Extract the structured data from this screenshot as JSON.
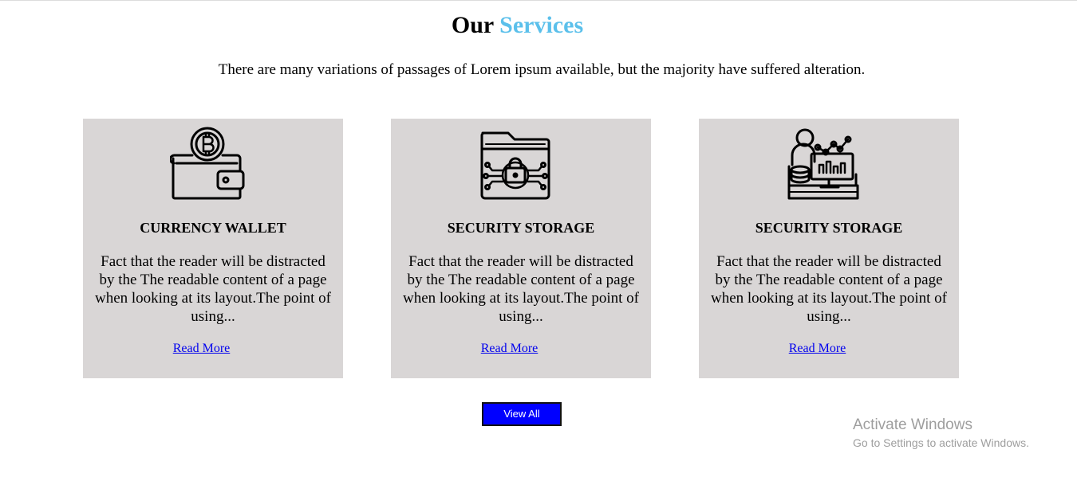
{
  "header": {
    "title_main": "Our",
    "title_accent": "Services",
    "subtitle": "There are many variations of passages of Lorem ipsum available, but the majority have suffered alteration."
  },
  "colors": {
    "accent": "#5bc0eb",
    "card_bg": "#d9d6d6",
    "button_bg": "#0000ff",
    "link": "#0000ee"
  },
  "services": [
    {
      "icon": "bitcoin-wallet-icon",
      "title": "CURRENCY WALLET",
      "description": "Fact that the reader will be distracted by the The readable content of a page when looking at its layout.The point of using...",
      "link_label": "Read More"
    },
    {
      "icon": "secure-folder-icon",
      "title": "SECURITY STORAGE",
      "description": "Fact that the reader will be distracted by the The readable content of a page when looking at its layout.The point of using...",
      "link_label": "Read More"
    },
    {
      "icon": "trader-analytics-icon",
      "title": "SECURITY STORAGE",
      "description": "Fact that the reader will be distracted by the The readable content of a page when looking at its layout.The point of using...",
      "link_label": "Read More"
    }
  ],
  "actions": {
    "view_all_label": "View All"
  },
  "watermark": {
    "line1": "Activate Windows",
    "line2": "Go to Settings to activate Windows."
  }
}
